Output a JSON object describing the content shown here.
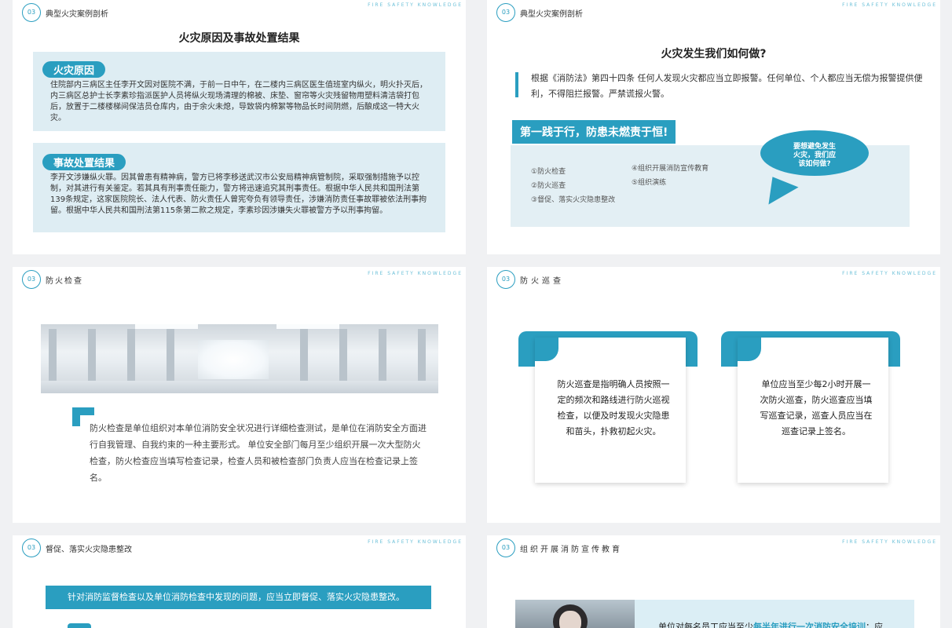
{
  "colors": {
    "accent": "#2a9ec0",
    "light_panel": "#deedf3",
    "background": "#f0f1f3"
  },
  "watermark": "FIRE SAFETY KNOWLEDGE",
  "slide1": {
    "badge": "03",
    "section": "典型火灾案例剖析",
    "title": "火灾原因及事故处置结果",
    "cause_label": "火灾原因",
    "cause_text": "住院部内三病区主任李开文因对医院不满，于前一日中午，在二楼内三病区医生值班室内纵火，明火扑灭后，内三病区总护士长李素珍指派医护人员将纵火现场清理的棉被、床垫、窗帘等火灾残留物用塑料清洁袋打包后，放置于二楼楼梯间保洁员仓库内，由于余火未熄，导致袋内棉絮等物品长时间阴燃，后酿成这一特大火灾。",
    "result_label": "事故处置结果",
    "result_text": "李开文涉嫌纵火罪。因其曾患有精神病，警方已将李移送武汉市公安局精神病管制院，采取强制措施予以控制，对其进行有关鉴定。若其具有刑事责任能力，警方将迅速追究其刑事责任。根据中华人民共和国刑法第139条规定，这家医院院长、法人代表、防火责任人曾宪夸负有领导责任，涉嫌消防责任事故罪被依法刑事拘留。根据中华人民共和国刑法第115条第二款之规定，李素珍因涉嫌失火罪被警方予以刑事拘留。"
  },
  "slide2": {
    "badge": "03",
    "section": "典型火灾案例剖析",
    "title": "火灾发生我们如何做?",
    "law_text": "根据《消防法》第四十四条 任何人发现火灾都应当立即报警。任何单位、个人都应当无偿为报警提供便利，不得阻拦报警。严禁谎报火警。",
    "banner": "第一践于行，防患未燃责于恒!",
    "list_left": [
      "①防火检查",
      "②防火巡查",
      "③督促、落实火灾隐患整改"
    ],
    "list_right": [
      "④组织开展消防宣传教育",
      "⑤组织演练"
    ],
    "bubble": [
      "要想避免发生",
      "火灾，我们应",
      "该如何做?"
    ]
  },
  "slide3": {
    "badge": "03",
    "section": "防火检查",
    "text": "防火检查是单位组织对本单位消防安全状况进行详细检查测试，是单位在消防安全方面进行自我管理、自我约束的一种主要形式。 单位安全部门每月至少组织开展一次大型防火检查，防火检查应当填写检查记录，检查人员和被检查部门负责人应当在检查记录上签名。"
  },
  "slide4": {
    "badge": "03",
    "section": "防火巡查",
    "card1": "防火巡查是指明确人员按照一定的频次和路线进行防火巡视检查，以便及时发现火灾隐患和苗头，扑救初起火灾。",
    "card2": "单位应当至少每2小时开展一次防火巡查，防火巡查应当填写巡查记录，巡查人员应当在巡查记录上签名。"
  },
  "slide5": {
    "badge": "03",
    "section": "督促、落实火灾隐患整改",
    "banner": "针对消防监督检查以及单位消防检查中发现的问题，应当立即督促、落实火灾隐患整改。"
  },
  "slide6": {
    "badge": "03",
    "section": "组织开展消防宣传教育",
    "text_before": "单位对每名员工应当至少",
    "text_highlight": "每半年进行一次消防安全培训",
    "text_after": "；应"
  }
}
